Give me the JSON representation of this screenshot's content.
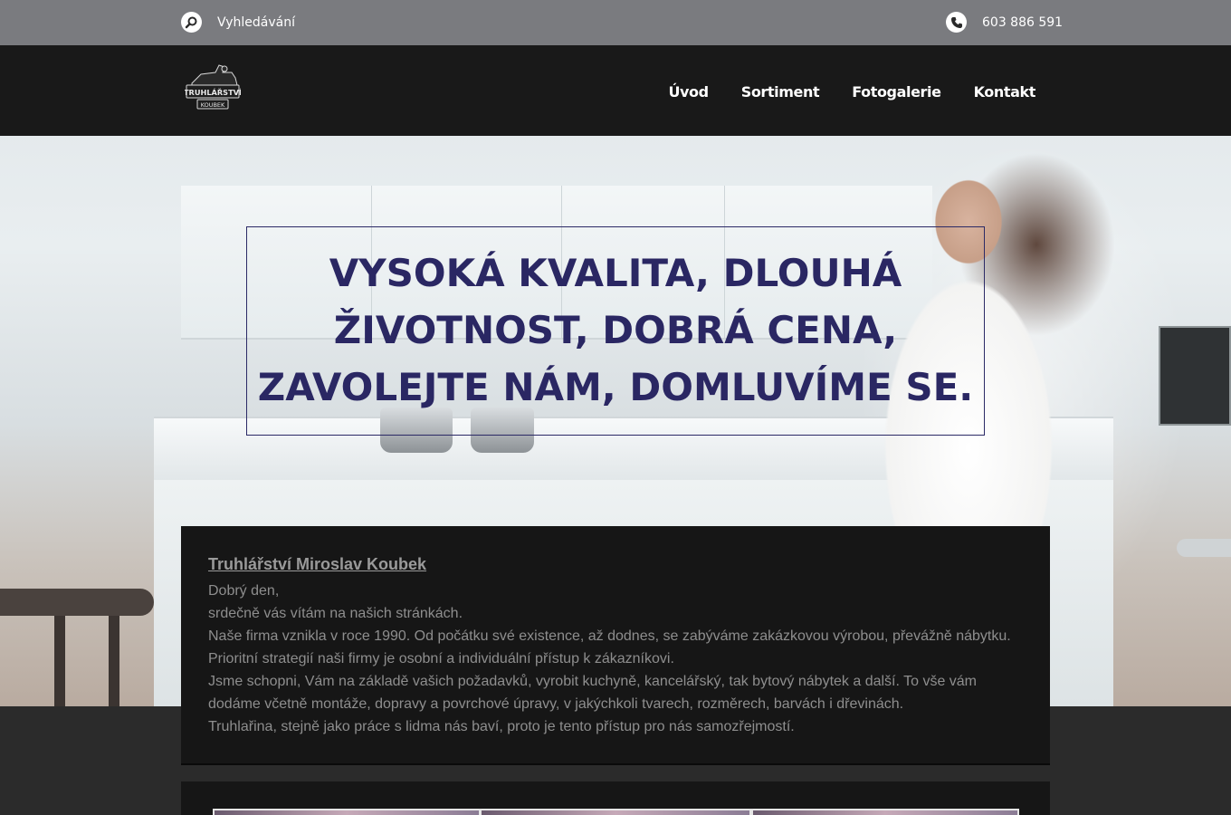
{
  "topbar": {
    "search_label": "Vyhledávání",
    "phone": "603 886 591",
    "search_icon": "search-icon",
    "phone_icon": "phone-icon"
  },
  "header": {
    "logo_text": "TRUHLÁŘSTVÍ",
    "logo_subtext": "KOUBEK",
    "nav": [
      {
        "label": "Úvod"
      },
      {
        "label": "Sortiment"
      },
      {
        "label": "Fotogalerie"
      },
      {
        "label": "Kontakt"
      }
    ]
  },
  "hero": {
    "lines": [
      "VYSOKÁ KVALITA, DLOUHÁ",
      "ŽIVOTNOST, DOBRÁ CENA,",
      "ZAVOLEJTE NÁM, DOMLUVÍME SE."
    ],
    "accent_color": "#2a2763"
  },
  "intro": {
    "title": "Truhlářství Miroslav Koubek",
    "paragraphs": [
      "Dobrý den,",
      "srdečně vás vítám na našich stránkách.",
      "Naše firma vznikla v roce 1990. Od počátku své existence, až dodnes, se zabýváme zakázkovou výrobou, převážně nábytku.",
      "Prioritní strategií naši firmy je osobní a individuální přístup k zákazníkovi.",
      "Jsme schopni, Vám na základě vašich požadavků, vyrobit kuchyně, kancelářský, tak bytový nábytek a další. To vše vám",
      "dodáme včetně montáže, dopravy a povrchové úpravy, v jakýchkoli tvarech, rozměrech, barvách i dřevinách.",
      "Truhlařina, stejně jako práce s lidma nás baví, proto je tento přístup pro nás samozřejmostí."
    ]
  }
}
